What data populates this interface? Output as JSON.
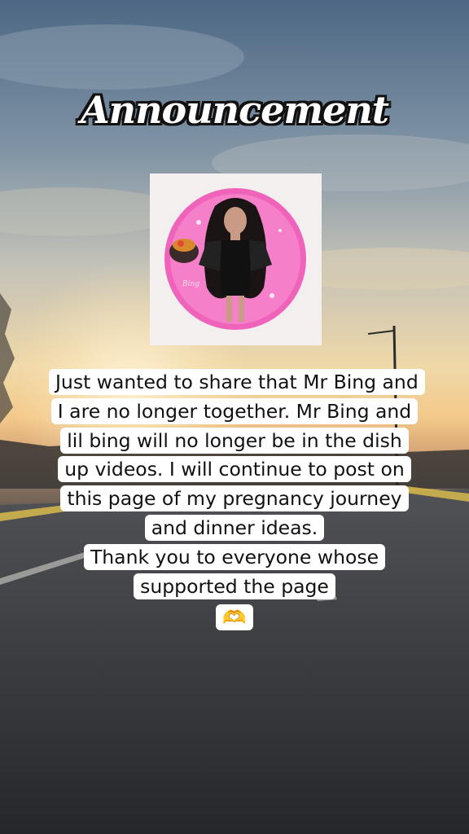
{
  "title": "Announcement",
  "avatar": {
    "icon": "pink-circle-avatar-icon",
    "accent": "#ee5fb6",
    "watermark_text": "Bing"
  },
  "message": {
    "paragraph1": "Just wanted to share that Mr Bing and I are no longer together. Mr Bing and lil bing will no longer be in the dish up videos. I will continue to post on this page of my pregnancy journey and dinner ideas.",
    "paragraph2": "Thank you to everyone whose supported the page",
    "emoji": "🫶"
  },
  "colors": {
    "caption_bg": "#ffffff",
    "caption_text": "#111111",
    "title_fill": "#ffffff",
    "title_outline": "#111111"
  }
}
